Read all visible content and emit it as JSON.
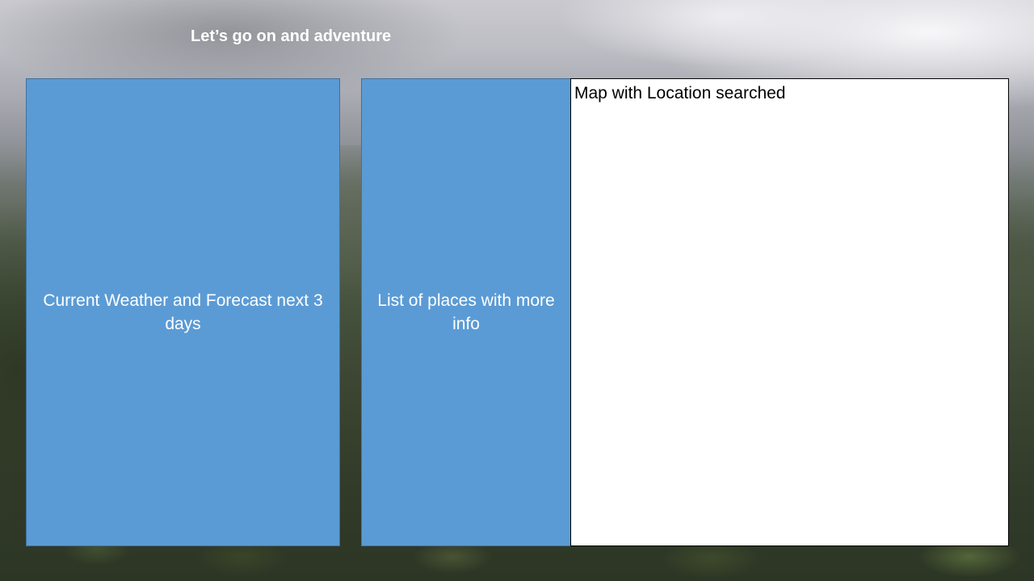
{
  "header": {
    "title": "Let’s go on and adventure"
  },
  "panels": {
    "weather": {
      "label": "Current Weather and Forecast next 3 days",
      "color": "#5b9bd5"
    },
    "places": {
      "label": "List of places with more info",
      "color": "#5b9bd5"
    },
    "map": {
      "label": "Map with Location searched",
      "color": "#ffffff"
    }
  }
}
